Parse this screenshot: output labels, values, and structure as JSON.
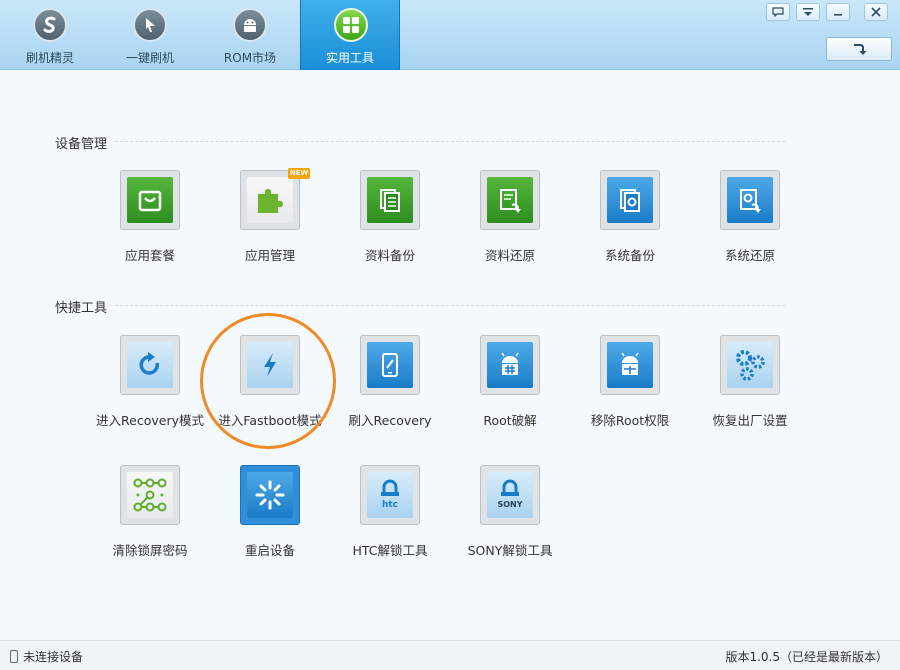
{
  "nav": {
    "tabs": [
      {
        "label": "刷机精灵"
      },
      {
        "label": "一键刷机"
      },
      {
        "label": "ROM市场"
      },
      {
        "label": "实用工具"
      }
    ]
  },
  "sections": {
    "device": {
      "title": "设备管理"
    },
    "quick": {
      "title": "快捷工具"
    }
  },
  "tools": {
    "app_suite": "应用套餐",
    "app_manage": "应用管理",
    "new_badge": "NEW",
    "data_backup": "资料备份",
    "data_restore": "资料还原",
    "sys_backup": "系统备份",
    "sys_restore": "系统还原",
    "recovery": "进入Recovery模式",
    "fastboot": "进入Fastboot模式",
    "flash_recovery": "刷入Recovery",
    "root": "Root破解",
    "unroot": "移除Root权限",
    "factory_reset": "恢复出厂设置",
    "clear_lock": "清除锁屏密码",
    "reboot": "重启设备",
    "htc_unlock": "HTC解锁工具",
    "htc_logo": "htc",
    "sony_unlock": "SONY解锁工具",
    "sony_logo": "SONY"
  },
  "status": {
    "left": "未连接设备",
    "right": "版本1.0.5（已经是最新版本）"
  },
  "colors": {
    "accent": "#1b8ed6",
    "green": "#3ea51a",
    "highlight_ring": "#f08a24"
  }
}
